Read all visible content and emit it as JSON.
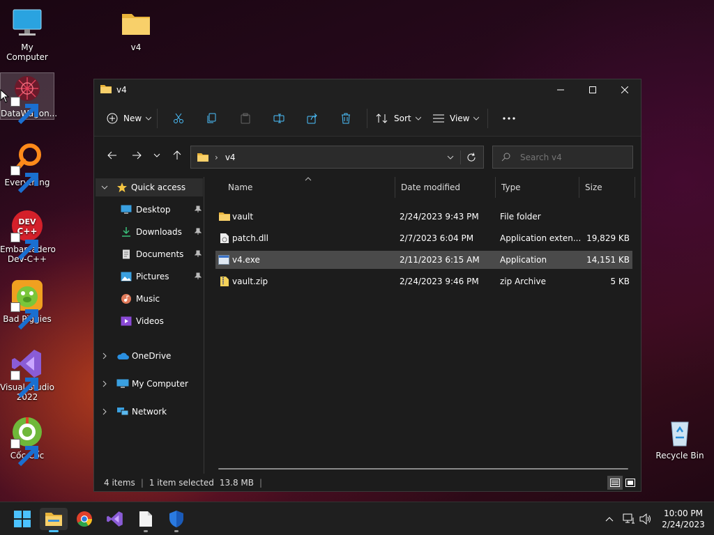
{
  "desktop": {
    "icons": [
      {
        "label": "My Computer"
      },
      {
        "label": "v4"
      },
      {
        "label": "DataWagon..."
      },
      {
        "label": "Everything"
      },
      {
        "label": "Embarcadero Dev-C++"
      },
      {
        "label": "Bad Piggies"
      },
      {
        "label": "Visual Studio 2022"
      },
      {
        "label": "Cốc Cốc"
      },
      {
        "label": "Recycle Bin"
      }
    ]
  },
  "window": {
    "title": "v4",
    "toolbar": {
      "new_label": "New",
      "sort_label": "Sort",
      "view_label": "View"
    },
    "address": {
      "path": "v4"
    },
    "search": {
      "placeholder": "Search v4"
    },
    "nav": {
      "quick_access": "Quick access",
      "items": [
        "Desktop",
        "Downloads",
        "Documents",
        "Pictures",
        "Music",
        "Videos"
      ],
      "onedrive": "OneDrive",
      "my_computer": "My Computer",
      "network": "Network"
    },
    "columns": [
      "Name",
      "Date modified",
      "Type",
      "Size"
    ],
    "files": [
      {
        "name": "vault",
        "date": "2/24/2023 9:43 PM",
        "type": "File folder",
        "size": ""
      },
      {
        "name": "patch.dll",
        "date": "2/7/2023 6:04 PM",
        "type": "Application exten...",
        "size": "19,829 KB"
      },
      {
        "name": "v4.exe",
        "date": "2/11/2023 6:15 AM",
        "type": "Application",
        "size": "14,151 KB"
      },
      {
        "name": "vault.zip",
        "date": "2/24/2023 9:46 PM",
        "type": "zip Archive",
        "size": "5 KB"
      }
    ],
    "status": {
      "count": "4 items",
      "selected": "1 item selected",
      "size": "13.8 MB"
    }
  },
  "taskbar": {
    "time": "10:00 PM",
    "date": "2/24/2023"
  },
  "colors": {
    "folder": "#f4c542",
    "accent": "#4cc2ff",
    "selected_row": "#4a4a4a"
  }
}
